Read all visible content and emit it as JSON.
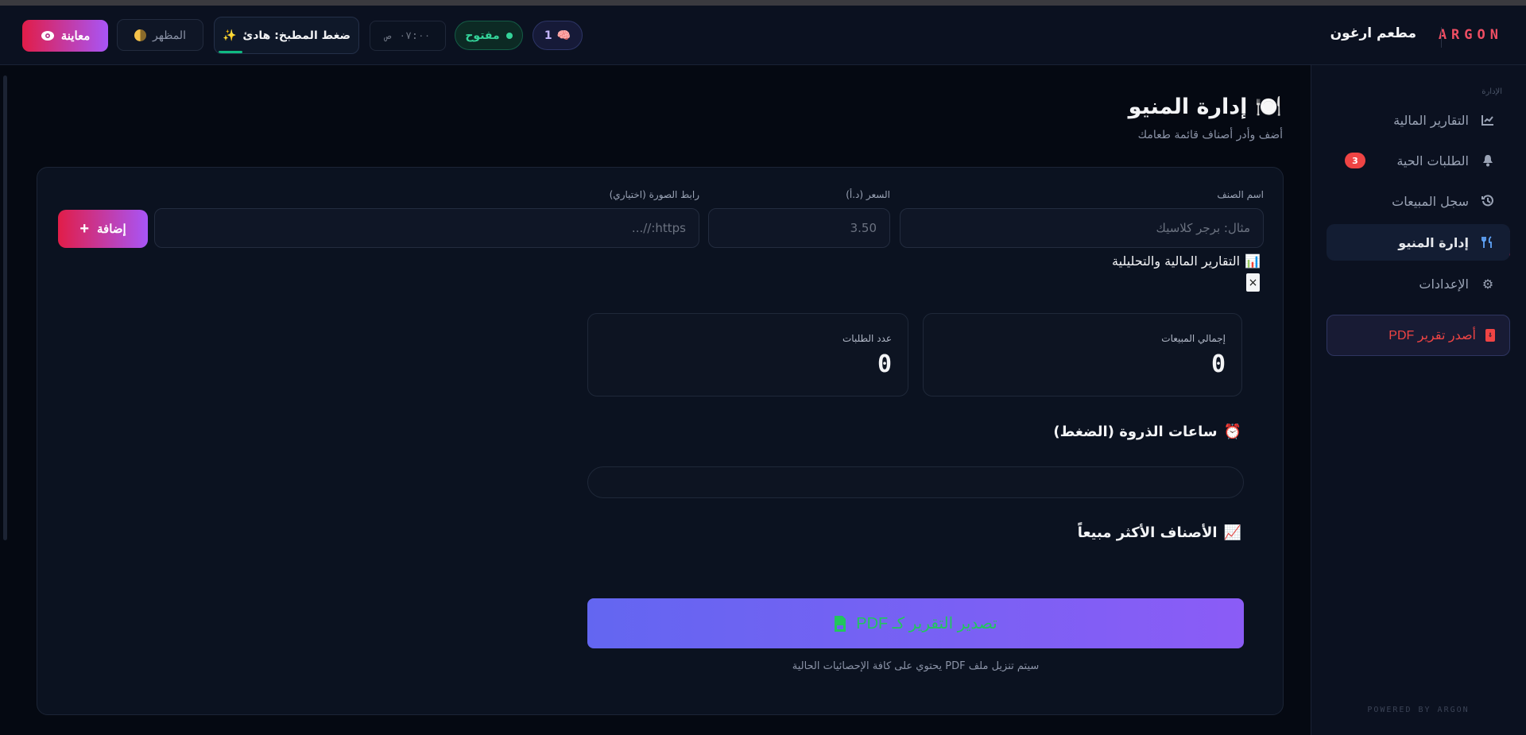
{
  "header": {
    "brand": "ARGON",
    "restaurant_name": "مطعم ارغون",
    "preview_label": "معاينة",
    "theme_label": "المظهر",
    "kitchen_pressure": "ضغط المطبخ: هادئ",
    "time": "٠٧:٠٠",
    "time_suffix": "ص",
    "status": "مفتوح",
    "active_count": "1"
  },
  "sidebar": {
    "section_label": "الإدارة",
    "items": [
      {
        "label": "التقارير المالية",
        "icon": "chart-line-icon"
      },
      {
        "label": "الطلبات الحية",
        "icon": "bell-icon",
        "badge": "3"
      },
      {
        "label": "سجل المبيعات",
        "icon": "history-icon"
      },
      {
        "label": "إدارة المنيو",
        "icon": "utensils-icon",
        "active": true
      },
      {
        "label": "الإعدادات",
        "icon": "gear-icon"
      }
    ],
    "pdf_button": "أصدر تقرير PDF",
    "powered_by": "POWERED BY ARGON"
  },
  "main": {
    "title": "إدارة المنيو",
    "subtitle": "أضف وأدر أصناف قائمة طعامك",
    "form": {
      "name_label": "اسم الصنف",
      "name_placeholder": "مثال: برجر كلاسيك",
      "price_label": "السعر (د.أ)",
      "price_placeholder": "3.50",
      "image_label": "رابط الصورة (اختياري)",
      "image_placeholder": "https://...",
      "add_button": "إضافة"
    },
    "report": {
      "title": "التقارير المالية والتحليلية",
      "close": "×",
      "total_sales_label": "إجمالي المبيعات",
      "total_sales_value": "0",
      "orders_count_label": "عدد الطلبات",
      "orders_count_value": "0",
      "peak_hours_title": "ساعات الذروة (الضغط)",
      "top_items_title": "الأصناف الأكثر مبيعاً",
      "export_button": "تصدير التقرير كـ PDF",
      "export_note": "سيتم تنزيل ملف PDF يحتوي على كافة الإحصائيات الحالية"
    }
  },
  "colors": {
    "accent": "#e11d48",
    "gradient_end": "#a855f7",
    "success": "#34d399",
    "background": "#050912"
  }
}
